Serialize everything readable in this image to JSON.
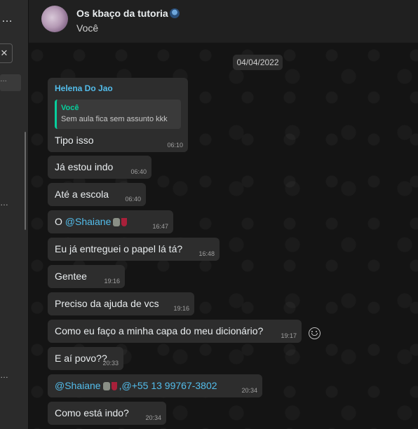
{
  "header": {
    "title": "Os kbaço da tutoria",
    "subtitle": "Você"
  },
  "chat": {
    "date": "04/04/2022",
    "first_message": {
      "sender": "Helena Do Jao",
      "quote_name": "Você",
      "quote_text": "Sem aula fica sem assunto kkk",
      "text": "Tipo isso",
      "time": "06:10"
    },
    "messages": [
      {
        "text": "Já estou indo",
        "time": "06:40"
      },
      {
        "text": "Até a escola",
        "time": "06:40"
      },
      {
        "prefix": "O ",
        "mention": "@Shaiane",
        "time": "16:47"
      },
      {
        "text": "Eu já entreguei o papel lá tá?",
        "time": "16:48"
      },
      {
        "text": "Gentee",
        "time": "19:16"
      },
      {
        "text": "Preciso da ajuda de vcs",
        "time": "19:16"
      },
      {
        "text": "Como eu faço a minha capa do meu dicionário?",
        "time": "19:17"
      },
      {
        "text": "E aí povo??",
        "time": "20:33"
      },
      {
        "mention": "@Shaiane",
        "mention2": ",@+55 13 99767-3802",
        "time": "20:34"
      },
      {
        "text": "Como está indo?",
        "time": "20:34"
      }
    ]
  },
  "icons": {
    "menu": "more-icon",
    "back": "close-icon",
    "react": "emoji-icon",
    "sticker": "sticker-icon",
    "wine": "wine-glass-icon"
  }
}
